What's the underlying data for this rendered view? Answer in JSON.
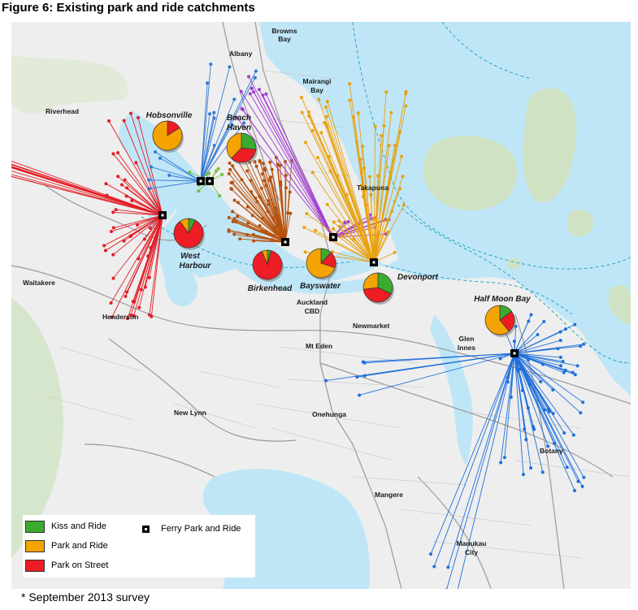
{
  "figure_title": "Figure 6: Existing park and ride catchments",
  "footnote": "* September 2013 survey",
  "colors": {
    "kiss_and_ride": "#3bab2f",
    "park_and_ride": "#f4a300",
    "park_on_street": "#ee1c24",
    "west_harbour_lines": "#e41b23",
    "hobsonville_lines": "#2f78d6",
    "beach_haven_lines": "#6fbf3d",
    "birkenhead_lines": "#b5520f",
    "bayswater_lines": "#a23ad0",
    "devonport_lines": "#e8a10d",
    "half_moon_bay_lines": "#1f6fdc",
    "sea": "#bfe6f7",
    "land": "#eeeeee"
  },
  "legend": {
    "kiss": "Kiss and Ride",
    "park": "Park and Ride",
    "street": "Park on Street",
    "ferry": "Ferry Park and Ride"
  },
  "place_labels": {
    "browns_bay": [
      "Browns",
      "Bay"
    ],
    "albany": "Albany",
    "mairangi_bay": [
      "Mairangi",
      "Bay"
    ],
    "riverhead": "Riverhead",
    "takapuna": "Takapuna",
    "waitakere": "Waitakere",
    "henderson": "Henderson",
    "auckland_cbd": [
      "Auckland",
      "CBD"
    ],
    "newmarket": "Newmarket",
    "glen_innes": [
      "Glen",
      "Innes"
    ],
    "mt_eden": "Mt Eden",
    "new_lynn": "New Lynn",
    "onehunga": "Onehunga",
    "botany": "Botany",
    "mangere": "Mangere",
    "manukau_city": [
      "Manukau",
      "City"
    ]
  },
  "terminals": {
    "hobsonville": "Hobsonville",
    "beach_haven": [
      "Beach",
      "Haven"
    ],
    "west_harbour": [
      "West",
      "Harbour"
    ],
    "birkenhead": "Birkenhead",
    "bayswater": "Bayswater",
    "devonport": "Devonport",
    "half_moon_bay": "Half Moon Bay"
  },
  "mode_share_pies": [
    {
      "terminal": "Hobsonville",
      "kiss_and_ride": 0.0,
      "park_and_ride": 0.84,
      "park_on_street": 0.16
    },
    {
      "terminal": "Beach Haven",
      "kiss_and_ride": 0.27,
      "park_and_ride": 0.38,
      "park_on_street": 0.35
    },
    {
      "terminal": "West Harbour",
      "kiss_and_ride": 0.08,
      "park_and_ride": 0.1,
      "park_on_street": 0.82
    },
    {
      "terminal": "Birkenhead",
      "kiss_and_ride": 0.04,
      "park_and_ride": 0.06,
      "park_on_street": 0.9
    },
    {
      "terminal": "Bayswater",
      "kiss_and_ride": 0.12,
      "park_and_ride": 0.7,
      "park_on_street": 0.18
    },
    {
      "terminal": "Devonport",
      "kiss_and_ride": 0.32,
      "park_and_ride": 0.27,
      "park_on_street": 0.41
    },
    {
      "terminal": "Half Moon Bay",
      "kiss_and_ride": 0.15,
      "park_and_ride": 0.61,
      "park_on_street": 0.24
    }
  ]
}
